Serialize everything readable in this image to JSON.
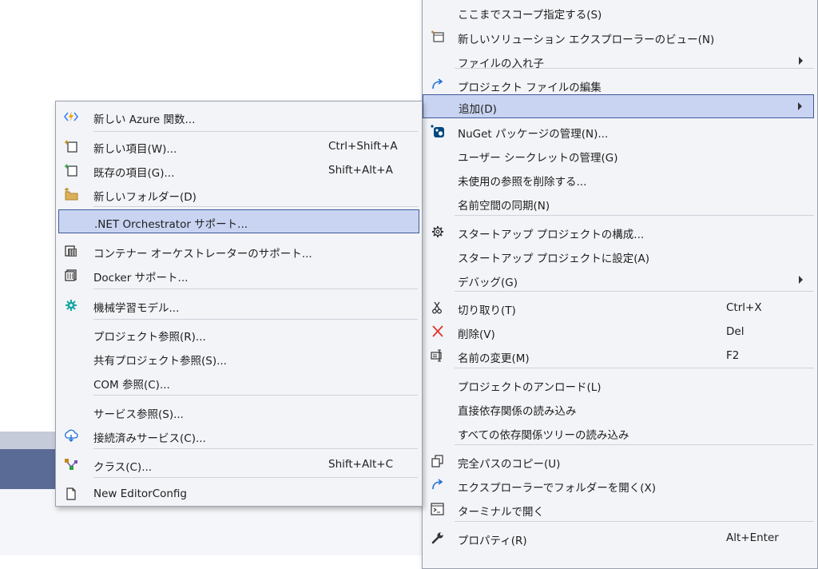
{
  "context_menu": {
    "items": [
      {
        "label": "ここまでスコープ指定する(S)",
        "icon": "none"
      },
      {
        "label": "新しいソリューション エクスプローラーのビュー(N)",
        "icon": "new-view-icon"
      },
      {
        "label": "ファイルの入れ子",
        "icon": "none",
        "submenu": true
      },
      {
        "label": "プロジェクト ファイルの編集",
        "icon": "edit-arrow-icon"
      },
      {
        "label": "追加(D)",
        "icon": "none",
        "submenu": true,
        "highlighted": true
      },
      {
        "label": "NuGet パッケージの管理(N)...",
        "icon": "nuget-icon"
      },
      {
        "label": "ユーザー シークレットの管理(G)",
        "icon": "none"
      },
      {
        "label": "未使用の参照を削除する...",
        "icon": "none"
      },
      {
        "label": "名前空間の同期(N)",
        "icon": "none"
      },
      {
        "label": "スタートアップ プロジェクトの構成...",
        "icon": "gear-icon"
      },
      {
        "label": "スタートアップ プロジェクトに設定(A)",
        "icon": "none"
      },
      {
        "label": "デバッグ(G)",
        "icon": "none",
        "submenu": true
      },
      {
        "label": "切り取り(T)",
        "icon": "scissors-icon",
        "shortcut": "Ctrl+X"
      },
      {
        "label": "削除(V)",
        "icon": "delete-x-icon",
        "shortcut": "Del"
      },
      {
        "label": "名前の変更(M)",
        "icon": "rename-icon",
        "shortcut": "F2"
      },
      {
        "label": "プロジェクトのアンロード(L)",
        "icon": "none"
      },
      {
        "label": "直接依存関係の読み込み",
        "icon": "none"
      },
      {
        "label": "すべての依存関係ツリーの読み込み",
        "icon": "none"
      },
      {
        "label": "完全パスのコピー(U)",
        "icon": "copy-icon"
      },
      {
        "label": "エクスプローラーでフォルダーを開く(X)",
        "icon": "open-folder-arrow-icon"
      },
      {
        "label": "ターミナルで開く",
        "icon": "terminal-icon"
      },
      {
        "label": "プロパティ(R)",
        "icon": "wrench-icon",
        "shortcut": "Alt+Enter"
      }
    ]
  },
  "add_submenu": {
    "items": [
      {
        "label": "新しい Azure 関数...",
        "icon": "azure-function-icon"
      },
      {
        "label": "新しい項目(W)...",
        "icon": "new-item-icon",
        "shortcut": "Ctrl+Shift+A"
      },
      {
        "label": "既存の項目(G)...",
        "icon": "existing-item-icon",
        "shortcut": "Shift+Alt+A"
      },
      {
        "label": "新しいフォルダー(D)",
        "icon": "new-folder-icon"
      },
      {
        "label": ".NET Orchestrator サポート...",
        "icon": "none",
        "highlighted": true
      },
      {
        "label": "コンテナー オーケストレーターのサポート...",
        "icon": "container-orchestrator-icon"
      },
      {
        "label": "Docker サポート...",
        "icon": "docker-icon"
      },
      {
        "label": "機械学習モデル...",
        "icon": "ml-model-icon"
      },
      {
        "label": "プロジェクト参照(R)...",
        "icon": "none"
      },
      {
        "label": "共有プロジェクト参照(S)...",
        "icon": "none"
      },
      {
        "label": "COM 参照(C)...",
        "icon": "none"
      },
      {
        "label": "サービス参照(S)...",
        "icon": "none"
      },
      {
        "label": "接続済みサービス(C)...",
        "icon": "connected-service-icon"
      },
      {
        "label": "クラス(C)...",
        "icon": "class-icon",
        "shortcut": "Shift+Alt+C"
      },
      {
        "label": "New EditorConfig",
        "icon": "document-icon"
      }
    ]
  },
  "colors": {
    "menu_bg": "#f3f4f8",
    "highlight_bg": "#c9d4f2",
    "highlight_border": "#3f5a9a",
    "accent_blue": "#1e6fd6",
    "delete_red": "#e0352b"
  }
}
